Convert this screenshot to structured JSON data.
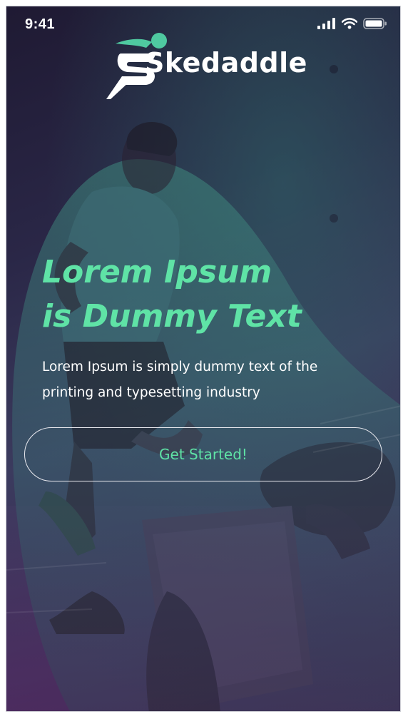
{
  "status_bar": {
    "time": "9:41",
    "icons": [
      "signal-icon",
      "wifi-icon",
      "battery-icon"
    ]
  },
  "logo": {
    "brand": "Skedaddle",
    "icon": "runner-s-logo-icon"
  },
  "hero": {
    "headline_line1": "Lorem Ipsum",
    "headline_line2": "is Dummy Text",
    "subtext": "Lorem Ipsum is simply dummy text of the printing and typesetting industry"
  },
  "cta": {
    "label": "Get Started!"
  },
  "colors": {
    "accent": "#5fe3a6",
    "background": "#2a2747",
    "text": "#ffffff",
    "button_border": "#e9e9ef"
  }
}
